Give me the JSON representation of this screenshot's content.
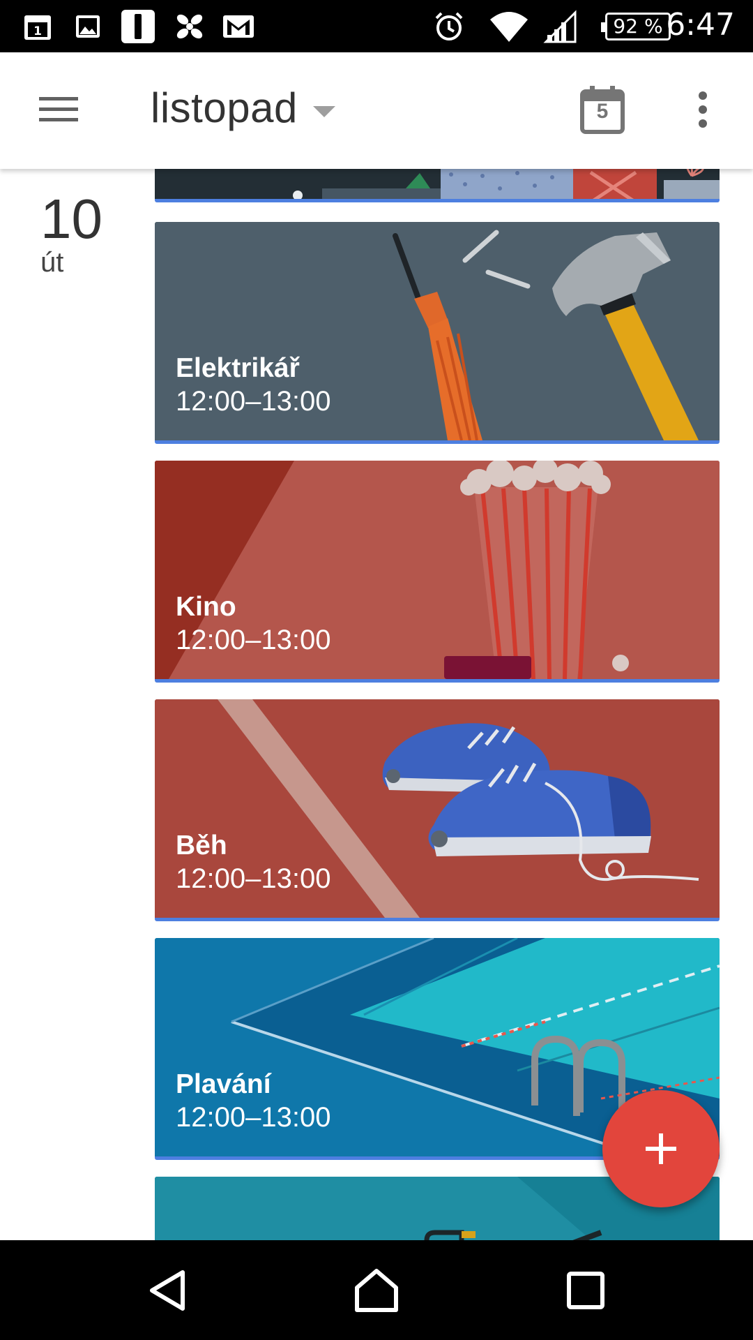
{
  "status_bar": {
    "time": "6:47",
    "battery": "92 %",
    "left_icons": [
      "calendar-1-icon",
      "image-icon",
      "notification-bar-icon",
      "fan-icon",
      "gmail-icon"
    ],
    "right_icons": [
      "alarm-icon",
      "wifi-icon",
      "signal-icon",
      "battery-icon"
    ]
  },
  "app_bar": {
    "title": "listopad",
    "today_number": "5",
    "icons": [
      "menu-icon",
      "dropdown-arrow-icon",
      "today-calendar-icon",
      "more-vert-icon"
    ]
  },
  "date": {
    "day": "10",
    "weekday": "út"
  },
  "events": [
    {
      "title": "Elektrikář",
      "time": "12:00–13:00",
      "color": "#4e5f6b"
    },
    {
      "title": "Kino",
      "time": "12:00–13:00",
      "color": "#b2554b"
    },
    {
      "title": "Běh",
      "time": "12:00–13:00",
      "color": "#a9473d"
    },
    {
      "title": "Plavání",
      "time": "12:00–13:00",
      "color": "#0f77aa"
    }
  ],
  "colors": {
    "accent_line": "#4d7fe0",
    "fab": "#e2453c",
    "status_bar": "#000000",
    "nav_bar": "#000000"
  },
  "fab": {
    "icon": "plus-icon"
  },
  "nav_bar": {
    "icons": [
      "back-icon",
      "home-icon",
      "recents-icon"
    ]
  }
}
